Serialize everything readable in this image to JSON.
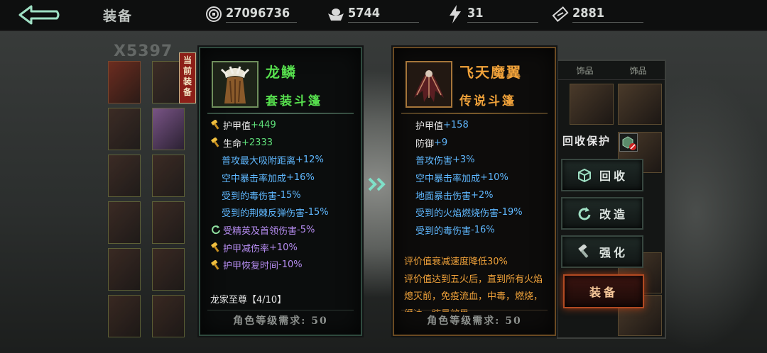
{
  "topbar": {
    "title": "装备",
    "resources": [
      {
        "icon": "coin-icon",
        "value": "27096736"
      },
      {
        "icon": "ingot-icon",
        "value": "5744"
      },
      {
        "icon": "lightning-icon",
        "value": "31"
      },
      {
        "icon": "ticket-icon",
        "value": "2881"
      }
    ]
  },
  "background": {
    "ghost_text": "X5397"
  },
  "current_item": {
    "ribbon": "当前装备",
    "name": "龙鳞",
    "type": "套装斗篷",
    "stats": [
      {
        "label": "护甲值",
        "value": "+449",
        "color": "white",
        "prefix": "hammer-icon"
      },
      {
        "label": "生命",
        "value": "+2333",
        "color": "white",
        "prefix": "hammer-icon"
      },
      {
        "label": "普攻最大吸附距离",
        "value": "+12%",
        "color": "blue",
        "prefix": ""
      },
      {
        "label": "空中暴击率加成",
        "value": "+16%",
        "color": "blue",
        "prefix": ""
      },
      {
        "label": "受到的毒伤害",
        "value": "-15%",
        "color": "blue",
        "prefix": ""
      },
      {
        "label": "受到的荆棘反弹伤害",
        "value": "-15%",
        "color": "blue",
        "prefix": ""
      },
      {
        "label": "受精英及首领伤害",
        "value": "-5%",
        "color": "purple",
        "prefix": "refresh-icon"
      },
      {
        "label": "护甲减伤率",
        "value": "+10%",
        "color": "purple",
        "prefix": "hammer-icon"
      },
      {
        "label": "护甲恢复时间",
        "value": "-10%",
        "color": "purple",
        "prefix": "hammer-icon"
      }
    ],
    "set_name": "龙家至尊【4/10】",
    "requirement": "角色等级需求: 50"
  },
  "compare_item": {
    "name": "飞天魔翼",
    "type": "传说斗篷",
    "stats": [
      {
        "label": "护甲值",
        "value": "+158",
        "color": "white"
      },
      {
        "label": "防御",
        "value": "+9",
        "color": "white"
      },
      {
        "label": "普攻伤害",
        "value": "+3%",
        "color": "blue"
      },
      {
        "label": "空中暴击率加成",
        "value": "+10%",
        "color": "blue"
      },
      {
        "label": "地面暴击伤害",
        "value": "+2%",
        "color": "blue"
      },
      {
        "label": "受到的火焰燃烧伤害",
        "value": "-19%",
        "color": "blue"
      },
      {
        "label": "受到的毒伤害",
        "value": "-16%",
        "color": "blue"
      }
    ],
    "description": "评价值衰减速度降低30%\n评价值达到五火后，直到所有火焰熄灭前，免疫流血，中毒，燃烧，缓速，眩晕效果",
    "requirement": "角色等级需求: 50"
  },
  "controls": {
    "recycle_protect": "回收保护",
    "recycle": "回收",
    "reforge": "改造",
    "enhance": "强化",
    "equip": "装备"
  },
  "inventory_tabs": [
    "饰品",
    "饰品"
  ],
  "colors": {
    "legendary": "#f0a23a",
    "set": "#57e04e",
    "blue_stat": "#5fb8ff",
    "purple_stat": "#b58cf0",
    "equip_glow": "#b24a22"
  }
}
